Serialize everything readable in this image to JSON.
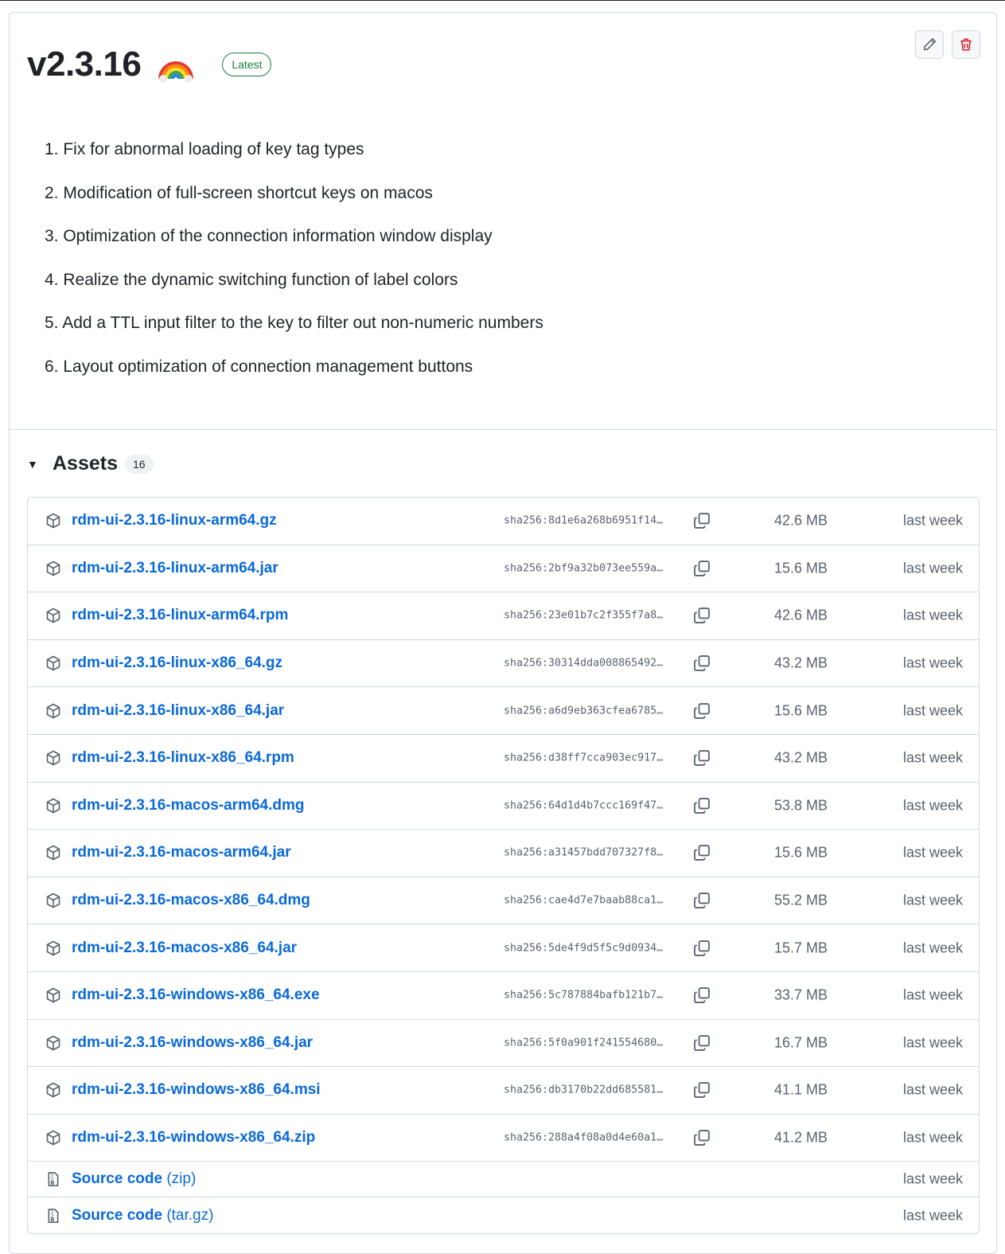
{
  "release": {
    "title": "v2.3.16",
    "emoji": "rainbow",
    "badge": "Latest",
    "edit_icon": "pencil-icon",
    "delete_icon": "trash-icon"
  },
  "notes": [
    "1. Fix for abnormal loading of key tag types",
    "2. Modification of full-screen shortcut keys on macos",
    "3. Optimization of the connection information window display",
    "4. Realize the dynamic switching function of label colors",
    "5. Add a TTL input filter to the key to filter out non-numeric numbers",
    "6. Layout optimization of connection management buttons"
  ],
  "assets": {
    "caret": "▼",
    "title": "Assets",
    "count": "16",
    "files": [
      {
        "name": "rdm-ui-2.3.16-linux-arm64.gz",
        "sha": "sha256:8d1e6a268b6951f14…",
        "size": "42.6 MB",
        "date": "last week"
      },
      {
        "name": "rdm-ui-2.3.16-linux-arm64.jar",
        "sha": "sha256:2bf9a32b073ee559a…",
        "size": "15.6 MB",
        "date": "last week"
      },
      {
        "name": "rdm-ui-2.3.16-linux-arm64.rpm",
        "sha": "sha256:23e01b7c2f355f7a8…",
        "size": "42.6 MB",
        "date": "last week"
      },
      {
        "name": "rdm-ui-2.3.16-linux-x86_64.gz",
        "sha": "sha256:30314dda008865492…",
        "size": "43.2 MB",
        "date": "last week"
      },
      {
        "name": "rdm-ui-2.3.16-linux-x86_64.jar",
        "sha": "sha256:a6d9eb363cfea6785…",
        "size": "15.6 MB",
        "date": "last week"
      },
      {
        "name": "rdm-ui-2.3.16-linux-x86_64.rpm",
        "sha": "sha256:d38ff7cca903ec917…",
        "size": "43.2 MB",
        "date": "last week"
      },
      {
        "name": "rdm-ui-2.3.16-macos-arm64.dmg",
        "sha": "sha256:64d1d4b7ccc169f47…",
        "size": "53.8 MB",
        "date": "last week"
      },
      {
        "name": "rdm-ui-2.3.16-macos-arm64.jar",
        "sha": "sha256:a31457bdd707327f8…",
        "size": "15.6 MB",
        "date": "last week"
      },
      {
        "name": "rdm-ui-2.3.16-macos-x86_64.dmg",
        "sha": "sha256:cae4d7e7baab88ca1…",
        "size": "55.2 MB",
        "date": "last week"
      },
      {
        "name": "rdm-ui-2.3.16-macos-x86_64.jar",
        "sha": "sha256:5de4f9d5f5c9d0934…",
        "size": "15.7 MB",
        "date": "last week"
      },
      {
        "name": "rdm-ui-2.3.16-windows-x86_64.exe",
        "sha": "sha256:5c787884bafb121b7…",
        "size": "33.7 MB",
        "date": "last week"
      },
      {
        "name": "rdm-ui-2.3.16-windows-x86_64.jar",
        "sha": "sha256:5f0a901f241554680…",
        "size": "16.7 MB",
        "date": "last week"
      },
      {
        "name": "rdm-ui-2.3.16-windows-x86_64.msi",
        "sha": "sha256:db3170b22dd685581…",
        "size": "41.1 MB",
        "date": "last week"
      },
      {
        "name": "rdm-ui-2.3.16-windows-x86_64.zip",
        "sha": "sha256:288a4f08a0d4e60a1…",
        "size": "41.2 MB",
        "date": "last week"
      }
    ],
    "source": [
      {
        "label": "Source code",
        "ext": "(zip)",
        "date": "last week"
      },
      {
        "label": "Source code",
        "ext": "(tar.gz)",
        "date": "last week"
      }
    ],
    "file_icon": "package-icon",
    "source_icon": "file-zip-icon",
    "copy_icon": "copy-icon"
  },
  "colors": {
    "link": "#0969da",
    "badge": "#1a7f37",
    "danger": "#cf222e",
    "muted": "#59636e",
    "border": "#d1d9e0"
  }
}
